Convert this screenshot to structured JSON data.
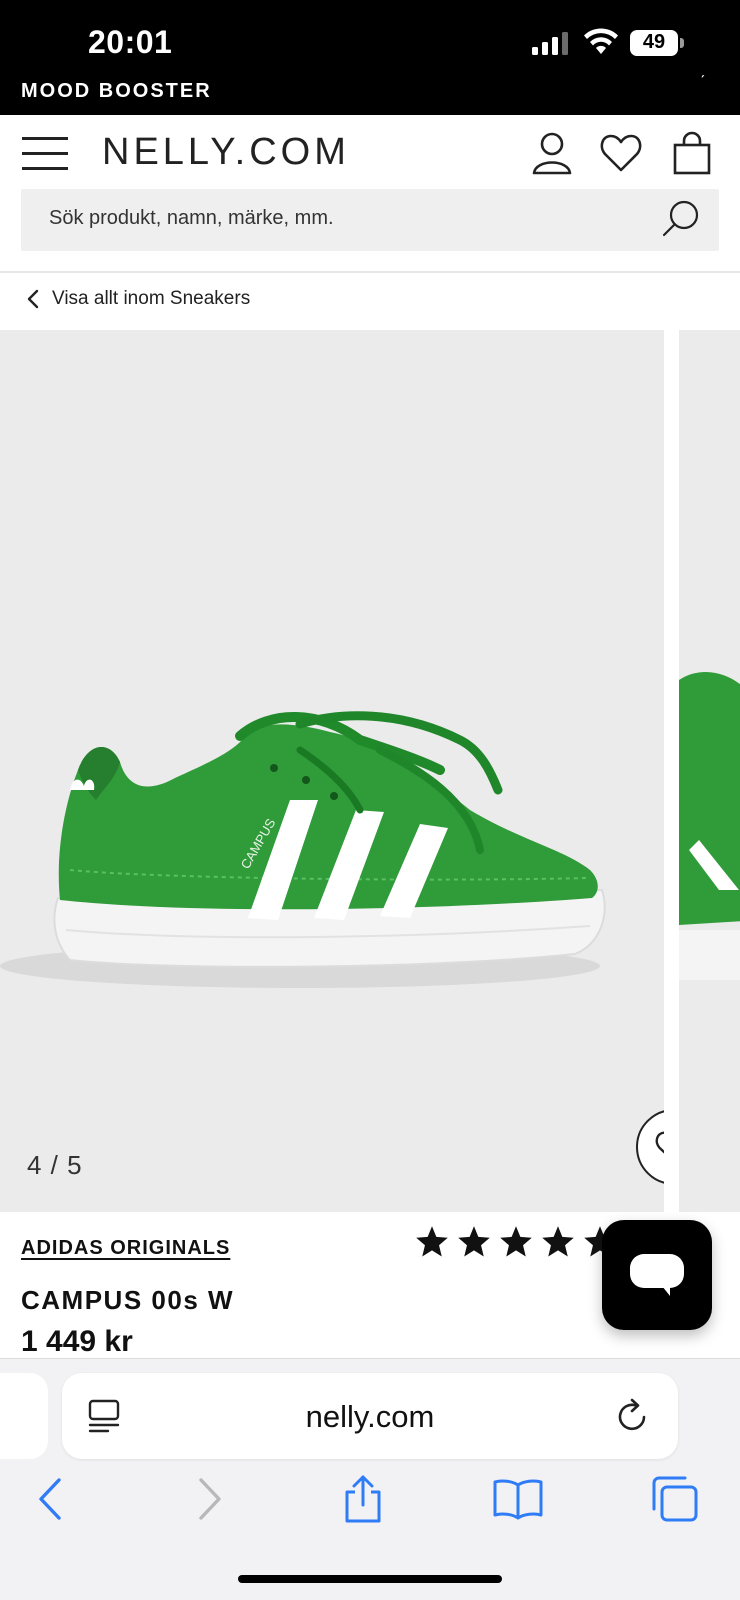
{
  "status_bar": {
    "time": "20:01",
    "battery": "49",
    "promo": "MOOD BOOSTER"
  },
  "header": {
    "logo": "NELLY.COM",
    "search_placeholder": "Sök produkt, namn, märke, mm."
  },
  "breadcrumb": {
    "back_label": "Visa allt inom Sneakers"
  },
  "gallery": {
    "counter": "4 / 5",
    "current": 4,
    "total": 5
  },
  "product": {
    "brand": "ADIDAS ORIGINALS",
    "name": "CAMPUS 00s W",
    "price": "1 449 kr",
    "rating_stars": 5,
    "review_count_partial": ")"
  },
  "browser": {
    "url": "nelly.com"
  },
  "colors": {
    "shoe_green": "#2e9a37",
    "background": "#ebebeb",
    "text": "#111111",
    "ios_blue": "#2f7cf6"
  }
}
